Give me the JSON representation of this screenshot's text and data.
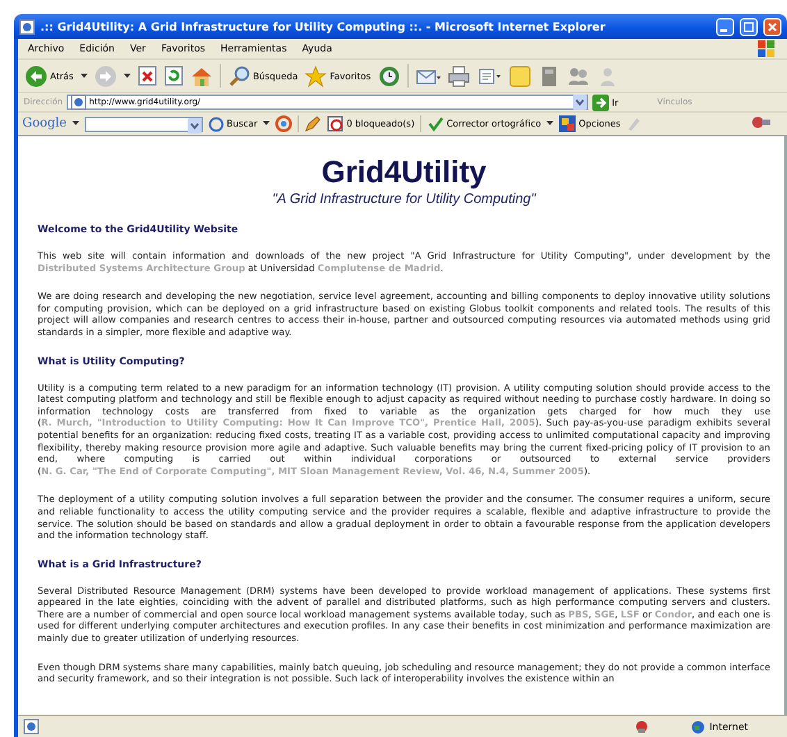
{
  "window": {
    "title": ".:: Grid4Utility: A Grid Infrastructure for Utility Computing ::. - Microsoft Internet Explorer"
  },
  "menu": [
    "Archivo",
    "Edición",
    "Ver",
    "Favoritos",
    "Herramientas",
    "Ayuda"
  ],
  "toolbar": {
    "back": "Atrás",
    "search": "Búsqueda",
    "favorites": "Favoritos"
  },
  "address_bar": {
    "label": "Dirección",
    "url": "http://www.grid4utility.org/",
    "go": "Ir",
    "links": "Vínculos"
  },
  "google_bar": {
    "logo": "Google",
    "search": "Buscar",
    "blocked": "0 bloqueado(s)",
    "spellcheck": "Corrector ortográfico",
    "options": "Opciones"
  },
  "page": {
    "title": "Grid4Utility",
    "subtitle": "\"A Grid Infrastructure for Utility Computing\"",
    "sections": [
      {
        "heading": "Welcome to the Grid4Utility Website",
        "paragraphs": [
          [
            {
              "text": "This web site will contain information and downloads of the new project \"A Grid Infrastructure for Utility Computing\", under development by the "
            },
            {
              "text": "Distributed Systems Architecture Group",
              "link": true
            },
            {
              "text": " at Universidad "
            },
            {
              "text": "Complutense de Madrid",
              "link": true
            },
            {
              "text": "."
            }
          ],
          [
            {
              "text": "We are doing research and developing the new negotiation, service level agreement, accounting and billing components to deploy innovative utility solutions for computing provision, which can be deployed on a grid infrastructure based on existing Globus toolkit components and related tools. The results of this project will allow companies and research centres to access their in-house, partner and outsourced computing resources via automated methods using grid standards in a simpler, more flexible and adaptive way."
            }
          ]
        ]
      },
      {
        "heading": "What is Utility Computing?",
        "paragraphs": [
          [
            {
              "text": "Utility is a computing term related to a new paradigm for an information technology (IT) provision. A utility computing solution should provide access to the latest computing platform and technology and still be flexible enough to adjust capacity as required without needing to purchase costly hardware. In doing so information technology costs are transferred from fixed to variable as the organization gets charged for how much they use ("
            },
            {
              "text": "R. Murch, \"Introduction to Utility Computing: How It Can Improve TCO\", Prentice Hall, 2005",
              "link": true
            },
            {
              "text": "). Such pay-as-you-use paradigm exhibits several potential benefits for an organization: reducing fixed costs, treating IT as a variable cost, providing access to unlimited computational capacity and improving flexibility, thereby making resource provision more agile and adaptive. Such valuable benefits may bring the current fixed-pricing policy of IT provision to an end, where computing is carried out within individual corporations or outsourced to external service providers ("
            },
            {
              "text": "N. G. Car, \"The End of Corporate Computing\", MIT Sloan Management Review, Vol. 46, N.4, Summer 2005",
              "link": true
            },
            {
              "text": ")."
            }
          ],
          [
            {
              "text": "The deployment of a utility computing solution involves a full separation between the provider and the consumer. The consumer requires a uniform, secure and reliable functionality to access the utility computing service and the provider requires a scalable, flexible and adaptive infrastructure to provide the service. The solution should be based on standards and allow a gradual deployment in order to obtain a favourable response from the application developers and the information technology staff."
            }
          ]
        ]
      },
      {
        "heading": "What is a Grid Infrastructure?",
        "paragraphs": [
          [
            {
              "text": "Several Distributed Resource Management (DRM) systems have been developed to provide workload management of applications. These systems first appeared in the late eighties, coinciding with the advent of parallel and distributed platforms, such as high performance computing servers and clusters. There are a number of commercial and open source local workload management systems available today, such as "
            },
            {
              "text": "PBS",
              "link": true
            },
            {
              "text": ", "
            },
            {
              "text": "SGE",
              "link": true
            },
            {
              "text": ", "
            },
            {
              "text": "LSF",
              "link": true
            },
            {
              "text": " or "
            },
            {
              "text": "Condor",
              "link": true
            },
            {
              "text": ", and each one is used for different underlying computer architectures and execution profiles. In any case their benefits in cost minimization and performance maximization are mainly due to greater utilization of underlying resources."
            }
          ],
          [
            {
              "text": "Even though DRM systems share many capabilities, mainly batch queuing, job scheduling and resource management; they do not provide a common interface and security framework, and so their integration is not possible. Such lack of interoperability involves the existence within an"
            }
          ]
        ]
      }
    ]
  },
  "status_bar": {
    "zone": "Internet"
  }
}
